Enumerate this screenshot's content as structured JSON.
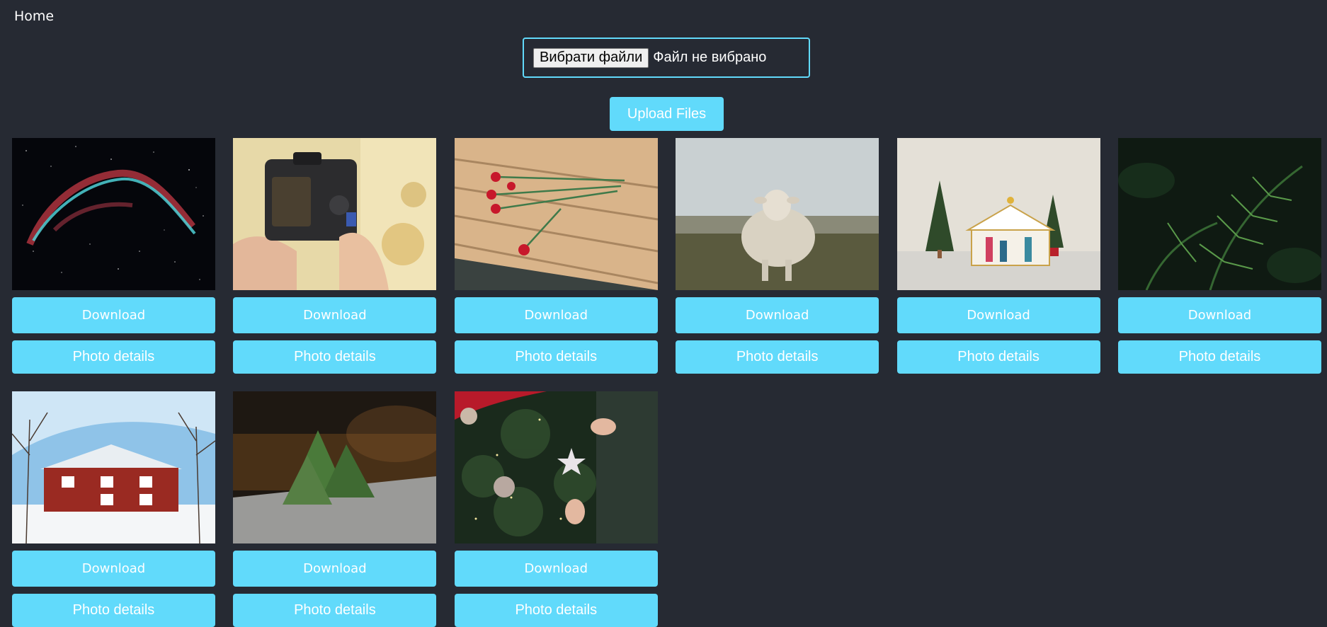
{
  "nav": {
    "home_label": "Home"
  },
  "upload": {
    "choose_button_label": "Вибрати файли",
    "file_status": "Файл не вибрано",
    "upload_button_label": "Upload Files"
  },
  "gallery": {
    "items": [
      {
        "image": "nebula-photo",
        "download_label": "Download",
        "details_label": "Photo details"
      },
      {
        "image": "camera-in-hands-photo",
        "download_label": "Download",
        "details_label": "Photo details"
      },
      {
        "image": "roses-on-bench-photo",
        "download_label": "Download",
        "details_label": "Photo details"
      },
      {
        "image": "sheep-photo",
        "download_label": "Download",
        "details_label": "Photo details"
      },
      {
        "image": "nativity-scene-photo",
        "download_label": "Download",
        "details_label": "Photo details"
      },
      {
        "image": "fern-photo",
        "download_label": "Download",
        "details_label": "Photo details"
      },
      {
        "image": "red-barn-snow-photo",
        "download_label": "Download",
        "details_label": "Photo details"
      },
      {
        "image": "paper-trees-photo",
        "download_label": "Download",
        "details_label": "Photo details"
      },
      {
        "image": "christmas-ornaments-photo",
        "download_label": "Download",
        "details_label": "Photo details"
      }
    ]
  },
  "colors": {
    "background": "#262a33",
    "accent": "#61dafb",
    "text": "#ffffff"
  }
}
